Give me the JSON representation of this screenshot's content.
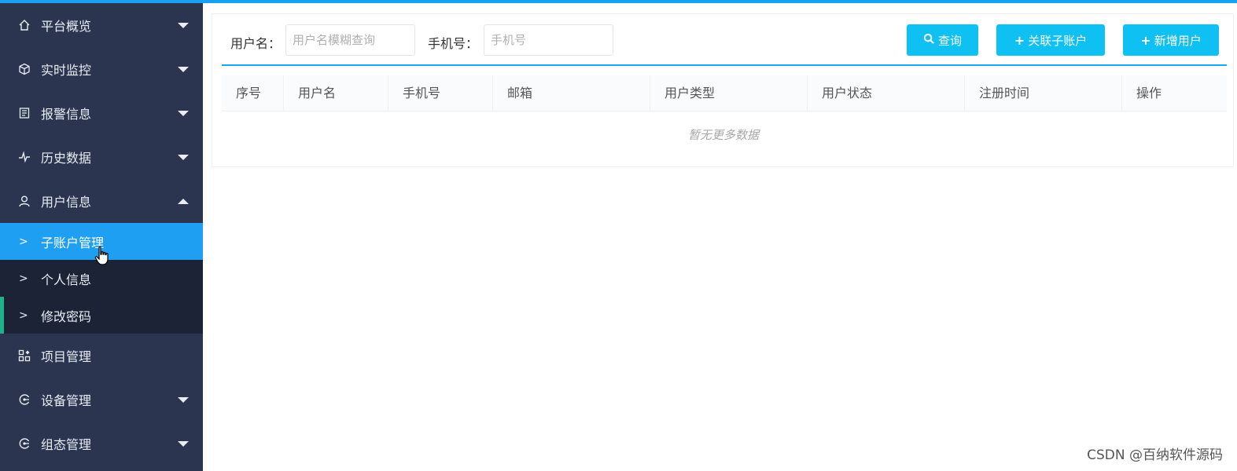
{
  "theme": {
    "sidebar_bg": "#2c3550",
    "submenu_bg": "#1c2336",
    "active_bg": "#1e9ff2",
    "accent": "#1aa0f0",
    "button_bg": "#0fc0f3",
    "marker": "#1fb38a"
  },
  "sidebar": {
    "items": [
      {
        "label": "平台概览",
        "icon": "home-icon",
        "caret": "down"
      },
      {
        "label": "实时监控",
        "icon": "cube-icon",
        "caret": "down"
      },
      {
        "label": "报警信息",
        "icon": "alarm-list-icon",
        "caret": "down"
      },
      {
        "label": "历史数据",
        "icon": "pulse-icon",
        "caret": "down"
      },
      {
        "label": "用户信息",
        "icon": "user-icon",
        "caret": "up"
      }
    ],
    "submenu": [
      {
        "label": "子账户管理",
        "active": true
      },
      {
        "label": "个人信息"
      },
      {
        "label": "修改密码"
      }
    ],
    "items_after": [
      {
        "label": "项目管理",
        "icon": "grid-icon"
      },
      {
        "label": "设备管理",
        "icon": "device-icon",
        "caret": "down"
      },
      {
        "label": "组态管理",
        "icon": "config-icon",
        "caret": "down"
      }
    ]
  },
  "filters": {
    "username_label": "用户名：",
    "username_placeholder": "用户名模糊查询",
    "phone_label": "手机号：",
    "phone_placeholder": "手机号"
  },
  "buttons": {
    "search": "查询",
    "link_sub": "关联子账户",
    "add_user": "新增用户"
  },
  "table": {
    "columns": [
      "序号",
      "用户名",
      "手机号",
      "邮箱",
      "用户类型",
      "用户状态",
      "注册时间",
      "操作"
    ],
    "empty_text": "暂无更多数据"
  },
  "watermark": "CSDN @百纳软件源码"
}
